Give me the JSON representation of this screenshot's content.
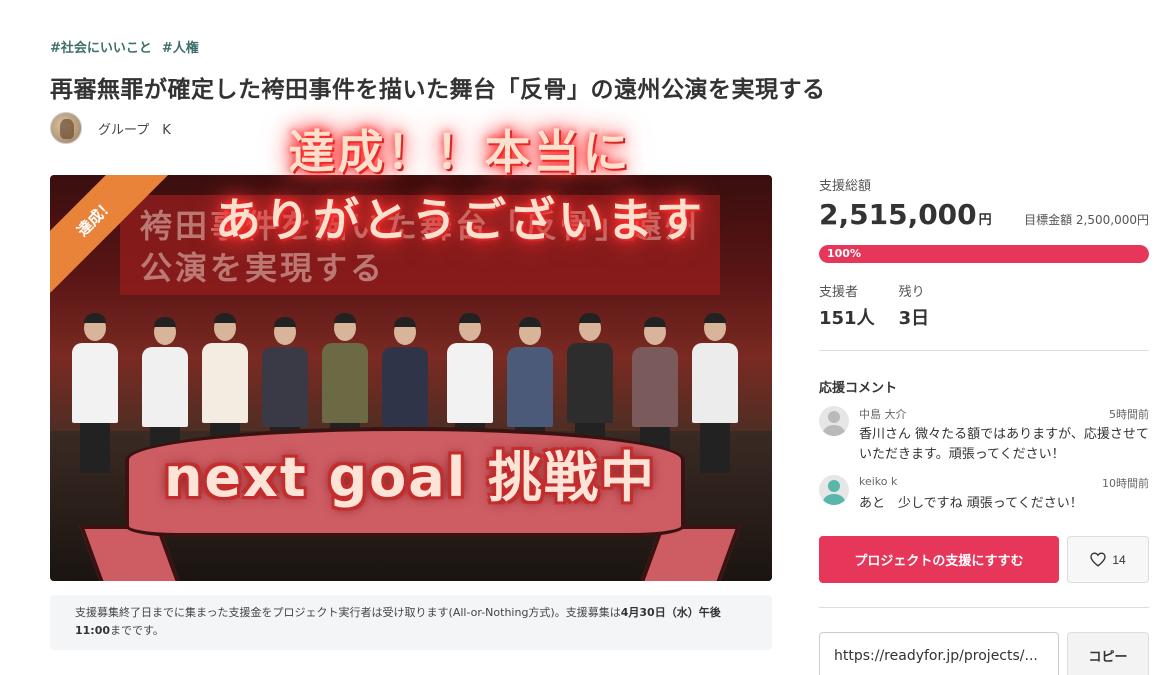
{
  "tags": [
    "#社会にいいこと",
    "#人権"
  ],
  "title": "再審無罪が確定した袴田事件を描いた舞台「反骨」の遠州公演を実現する",
  "owner": {
    "name": "グループ　K"
  },
  "hero": {
    "banner": "袴田事件を描いた舞台「反骨」遠州公演を実現する",
    "corner_badge": "達成！",
    "thanks_line1": "達成！！本当に",
    "thanks_line2": "ありがとうございます",
    "goal_text": "next goal 挑戦中"
  },
  "notice": {
    "text_part1": "支援募集終了日までに集まった支援金をプロジェクト実行者は受け取ります(All-or-Nothing方式)。支援募集は",
    "deadline": "4月30日（水）午後11:00",
    "text_part2": "までです。"
  },
  "funding": {
    "total_label": "支援総額",
    "total_amount": "2,515,000",
    "unit": "円",
    "target_label": "目標金額",
    "target_amount": "2,500,000円",
    "progress_text": "100%",
    "progress_fraction": 1.0,
    "backers_label": "支援者",
    "backers_value": "151人",
    "remaining_label": "残り",
    "remaining_value": "3日"
  },
  "comments": {
    "heading": "応援コメント",
    "items": [
      {
        "name": "中島 大介",
        "time": "5時間前",
        "text": "香川さん 微々たる額ではありますが、応援させていただきます。頑張ってください！"
      },
      {
        "name": "keiko k",
        "time": "10時間前",
        "text": "あと　少しですね 頑張ってください！"
      }
    ]
  },
  "actions": {
    "support_label": "プロジェクトの支援にすすむ",
    "like_count": "14"
  },
  "share": {
    "url": "https://readyfor.jp/projects/...",
    "copy_label": "コピー"
  },
  "colors": {
    "accent": "#e6365a",
    "tag": "#3f6f6b",
    "badge": "#e9833a"
  }
}
